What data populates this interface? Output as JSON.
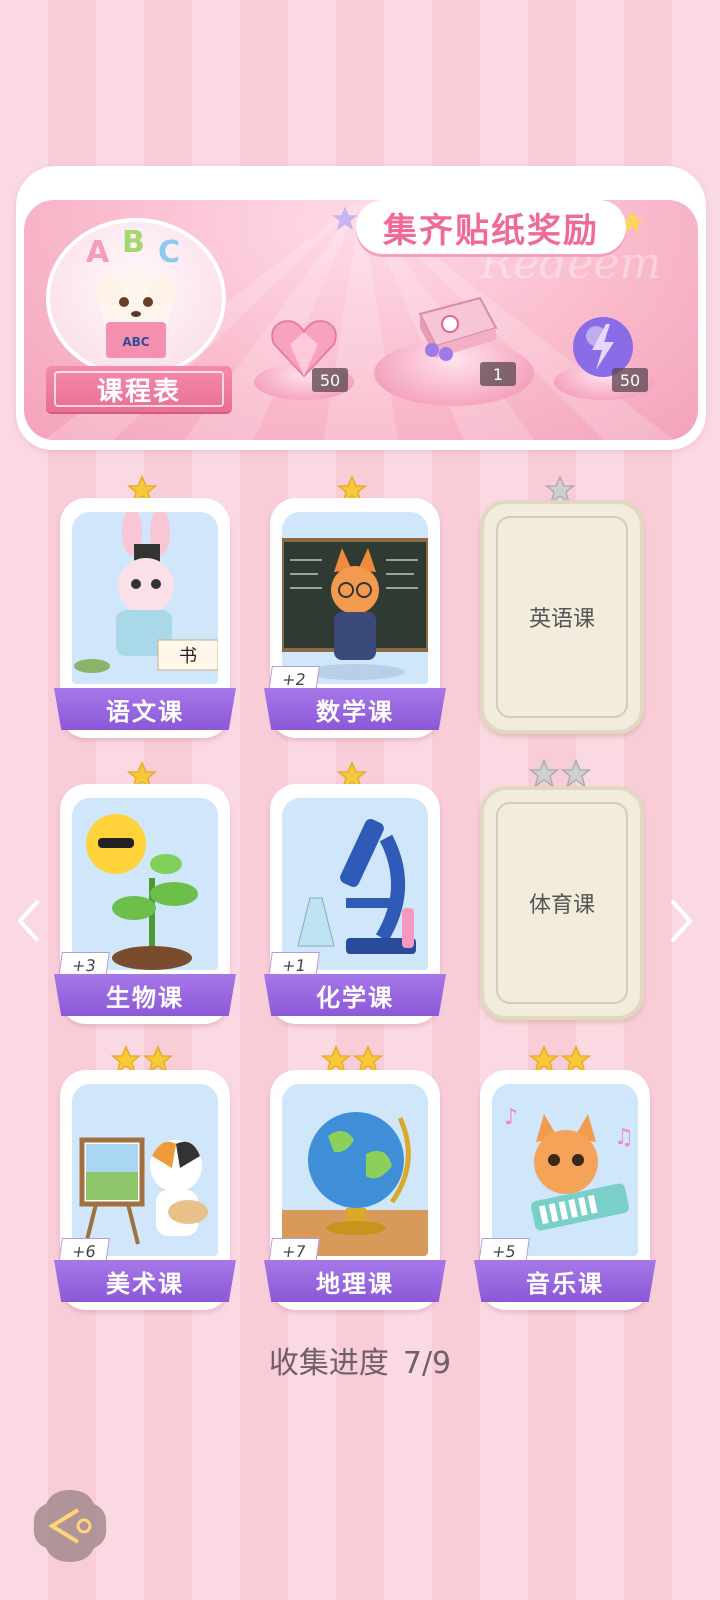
{
  "banner": {
    "title": "集齐贴纸奖励",
    "watermark": "Redeem",
    "schedule_label": "课程表",
    "avatar_book_text": "ABC",
    "avatar_letters": "ABC",
    "rewards": [
      {
        "icon": "heart-gem-icon",
        "count": "50"
      },
      {
        "icon": "gift-box-icon",
        "count": "1"
      },
      {
        "icon": "lightning-orb-icon",
        "count": "50"
      }
    ]
  },
  "cards": [
    {
      "label": "语文课",
      "stars": 1,
      "plus": "",
      "locked": false,
      "icon": "bunny-calligraphy-icon"
    },
    {
      "label": "数学课",
      "stars": 1,
      "plus": "+2",
      "locked": false,
      "icon": "fox-teacher-icon"
    },
    {
      "label": "英语课",
      "stars": 1,
      "plus": "",
      "locked": true,
      "icon": ""
    },
    {
      "label": "生物课",
      "stars": 1,
      "plus": "+3",
      "locked": false,
      "icon": "sprout-sun-icon"
    },
    {
      "label": "化学课",
      "stars": 1,
      "plus": "+1",
      "locked": false,
      "icon": "microscope-icon"
    },
    {
      "label": "体育课",
      "stars": 2,
      "plus": "",
      "locked": true,
      "icon": ""
    },
    {
      "label": "美术课",
      "stars": 2,
      "plus": "+6",
      "locked": false,
      "icon": "cat-painter-icon"
    },
    {
      "label": "地理课",
      "stars": 2,
      "plus": "+7",
      "locked": false,
      "icon": "globe-icon"
    },
    {
      "label": "音乐课",
      "stars": 2,
      "plus": "+5",
      "locked": false,
      "icon": "cat-keyboard-icon"
    }
  ],
  "progress": {
    "label": "收集进度",
    "value": "7/9"
  },
  "colors": {
    "accent": "#f06a98",
    "label_purple": "#9463dc",
    "star_gold": "#f7c83a",
    "star_gray": "#c9c9c9"
  }
}
